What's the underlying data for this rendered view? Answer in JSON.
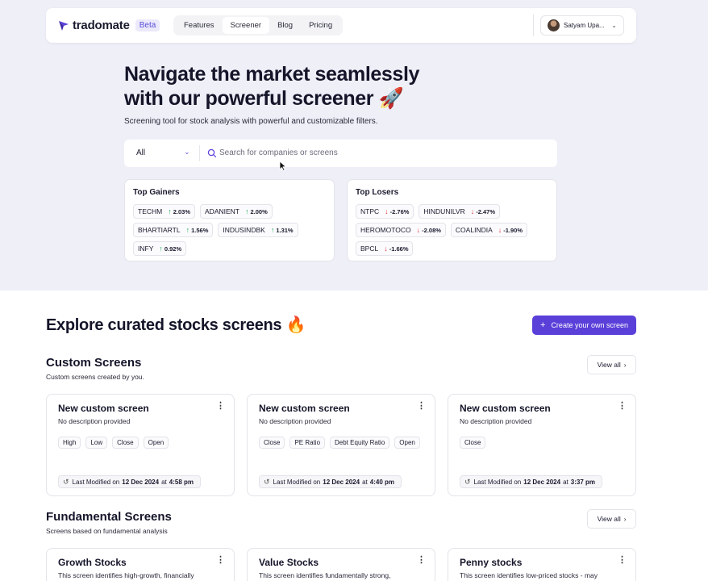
{
  "brand": {
    "name": "tradomate",
    "badge": "Beta",
    "accent": "#5b3fd9"
  },
  "nav": {
    "items": [
      {
        "label": "Features"
      },
      {
        "label": "Screener"
      },
      {
        "label": "Blog"
      },
      {
        "label": "Pricing"
      }
    ],
    "active": "Screener"
  },
  "user": {
    "name": "Satyam Upa..."
  },
  "hero": {
    "title_line1": "Navigate the market seamlessly",
    "title_line2": "with our powerful screener 🚀",
    "subtitle": "Screening tool for stock analysis with powerful and customizable filters."
  },
  "search": {
    "filter_value": "All",
    "placeholder": "Search for companies or screens"
  },
  "gainers": {
    "title": "Top Gainers",
    "items": [
      {
        "symbol": "TECHM",
        "change": "2.03%"
      },
      {
        "symbol": "ADANIENT",
        "change": "2.00%"
      },
      {
        "symbol": "BHARTIARTL",
        "change": "1.56%"
      },
      {
        "symbol": "INDUSINDBK",
        "change": "1.31%"
      },
      {
        "symbol": "INFY",
        "change": "0.92%"
      }
    ]
  },
  "losers": {
    "title": "Top Losers",
    "items": [
      {
        "symbol": "NTPC",
        "change": "-2.76%"
      },
      {
        "symbol": "HINDUNILVR",
        "change": "-2.47%"
      },
      {
        "symbol": "HEROMOTOCO",
        "change": "-2.08%"
      },
      {
        "symbol": "COALINDIA",
        "change": "-1.90%"
      },
      {
        "symbol": "BPCL",
        "change": "-1.66%"
      }
    ]
  },
  "explore": {
    "title": "Explore curated stocks screens 🔥",
    "create_label": "Create your own screen"
  },
  "custom": {
    "title": "Custom Screens",
    "subtitle": "Custom screens created by you.",
    "view_all": "View all",
    "cards": [
      {
        "title": "New custom screen",
        "desc": "No description provided",
        "tags": [
          "High",
          "Low",
          "Close",
          "Open"
        ],
        "modified_prefix": "Last Modified on",
        "date": "12 Dec 2024",
        "at": "at",
        "time": "4:58 pm"
      },
      {
        "title": "New custom screen",
        "desc": "No description provided",
        "tags": [
          "Close",
          "PE Ratio",
          "Debt Equity Ratio",
          "Open"
        ],
        "modified_prefix": "Last Modified on",
        "date": "12 Dec 2024",
        "at": "at",
        "time": "4:40 pm"
      },
      {
        "title": "New custom screen",
        "desc": "No description provided",
        "tags": [
          "Close"
        ],
        "modified_prefix": "Last Modified on",
        "date": "12 Dec 2024",
        "at": "at",
        "time": "3:37 pm"
      }
    ]
  },
  "fundamental": {
    "title": "Fundamental Screens",
    "subtitle": "Screens based on fundamental analysis",
    "view_all": "View all",
    "cards": [
      {
        "title": "Growth Stocks",
        "desc": "This screen identifies high-growth, financially"
      },
      {
        "title": "Value Stocks",
        "desc": "This screen identifies fundamentally strong,"
      },
      {
        "title": "Penny stocks",
        "desc": "This screen identifies low-priced stocks - may"
      }
    ]
  }
}
